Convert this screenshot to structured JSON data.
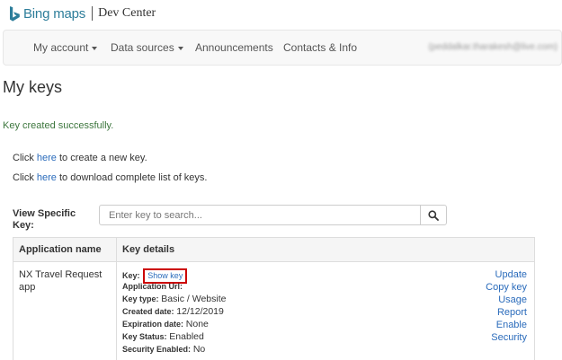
{
  "brand": {
    "name": "Bing maps",
    "sub": "Dev Center",
    "logo_icon": "bing-logo-icon",
    "logo_color": "#2d7d9a"
  },
  "nav": {
    "items": [
      {
        "label": "My account",
        "dropdown": true
      },
      {
        "label": "Data sources",
        "dropdown": true
      },
      {
        "label": "Announcements",
        "dropdown": false
      },
      {
        "label": "Contacts & Info",
        "dropdown": false
      }
    ],
    "user": "(peddalkar.tharakesh@live.com)"
  },
  "page": {
    "title": "My keys",
    "success": "Key created successfully.",
    "create_prefix": "Click",
    "create_link": "here",
    "create_suffix": "to create a new key.",
    "download_prefix": "Click",
    "download_link": "here",
    "download_suffix": "to download complete list of keys."
  },
  "search": {
    "label": "View Specific Key:",
    "placeholder": "Enter key to search...",
    "button_icon": "search-icon"
  },
  "table": {
    "headers": [
      "Application name",
      "Key details"
    ],
    "rows": [
      {
        "app_name": "NX Travel Request app",
        "key_label": "Key:",
        "show_key": "Show key",
        "url_label": "Application Url:",
        "type_label": "Key type:",
        "type_value": "Basic / Website",
        "created_label": "Created date:",
        "created_value": "12/12/2019",
        "expiration_label": "Expiration date:",
        "expiration_value": "None",
        "status_label": "Key Status:",
        "status_value": "Enabled",
        "security_label": "Security Enabled:",
        "security_value": "No",
        "actions": [
          "Update",
          "Copy key",
          "Usage",
          "Report",
          "Enable",
          "Security"
        ]
      }
    ]
  },
  "colors": {
    "link": "#2a6bbb",
    "success": "#3c763d",
    "highlight_border": "#cc0000"
  }
}
